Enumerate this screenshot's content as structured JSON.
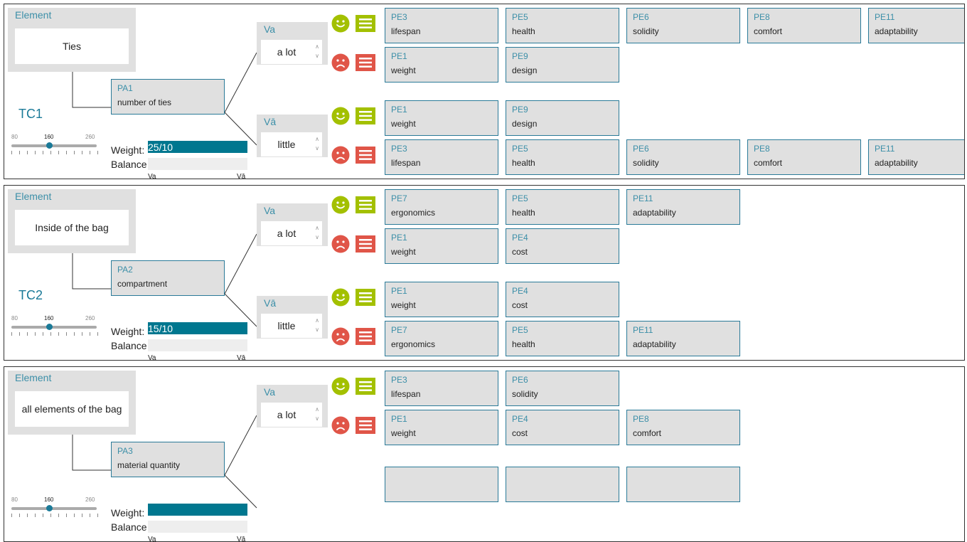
{
  "labels": {
    "element_title": "Element",
    "weight": "Weight:",
    "balance": "Balance",
    "va": "Va",
    "va_alt": "Vā"
  },
  "slider": {
    "min": "80",
    "mid": "160",
    "max": "260"
  },
  "colors": {
    "accent": "#00778f",
    "positive": "#a3c000",
    "negative": "#e05548"
  },
  "icons": {
    "positive": "smiley-face-icon",
    "negative": "sad-face-icon",
    "menu": "list-menu-icon"
  },
  "test_cases": [
    {
      "label": "TC1",
      "element": "Ties",
      "pa": {
        "code": "PA1",
        "label": "number of ties"
      },
      "weight": "25/10",
      "slider_value": 160,
      "values": [
        {
          "title": "Va",
          "value": "a lot",
          "positive_pe": [
            {
              "code": "PE3",
              "label": "lifespan"
            },
            {
              "code": "PE5",
              "label": "health"
            },
            {
              "code": "PE6",
              "label": "solidity"
            },
            {
              "code": "PE8",
              "label": "comfort"
            },
            {
              "code": "PE11",
              "label": "adaptability"
            }
          ],
          "negative_pe": [
            {
              "code": "PE1",
              "label": "weight"
            },
            {
              "code": "PE9",
              "label": "design"
            }
          ]
        },
        {
          "title": "Vā",
          "value": "little",
          "positive_pe": [
            {
              "code": "PE1",
              "label": "weight"
            },
            {
              "code": "PE9",
              "label": "design"
            }
          ],
          "negative_pe": [
            {
              "code": "PE3",
              "label": "lifespan"
            },
            {
              "code": "PE5",
              "label": "health"
            },
            {
              "code": "PE6",
              "label": "solidity"
            },
            {
              "code": "PE8",
              "label": "comfort"
            },
            {
              "code": "PE11",
              "label": "adaptability"
            }
          ]
        }
      ]
    },
    {
      "label": "TC2",
      "element": "Inside of the bag",
      "pa": {
        "code": "PA2",
        "label": "compartment"
      },
      "weight": "15/10",
      "slider_value": 160,
      "values": [
        {
          "title": "Va",
          "value": "a lot",
          "positive_pe": [
            {
              "code": "PE7",
              "label": "ergonomics"
            },
            {
              "code": "PE5",
              "label": "health"
            },
            {
              "code": "PE11",
              "label": "adaptability"
            }
          ],
          "negative_pe": [
            {
              "code": "PE1",
              "label": "weight"
            },
            {
              "code": "PE4",
              "label": "cost"
            }
          ]
        },
        {
          "title": "Vā",
          "value": "little",
          "positive_pe": [
            {
              "code": "PE1",
              "label": "weight"
            },
            {
              "code": "PE4",
              "label": "cost"
            }
          ],
          "negative_pe": [
            {
              "code": "PE7",
              "label": "ergonomics"
            },
            {
              "code": "PE5",
              "label": "health"
            },
            {
              "code": "PE11",
              "label": "adaptability"
            }
          ]
        }
      ]
    },
    {
      "label": "",
      "element": "all elements of the bag",
      "pa": {
        "code": "PA3",
        "label": "material quantity"
      },
      "weight": "",
      "slider_value": 160,
      "values": [
        {
          "title": "Va",
          "value": "a lot",
          "positive_pe": [
            {
              "code": "PE3",
              "label": "lifespan"
            },
            {
              "code": "PE6",
              "label": "solidity"
            }
          ],
          "negative_pe": [
            {
              "code": "PE1",
              "label": "weight"
            },
            {
              "code": "PE4",
              "label": "cost"
            },
            {
              "code": "PE8",
              "label": "comfort"
            }
          ]
        }
      ]
    }
  ]
}
